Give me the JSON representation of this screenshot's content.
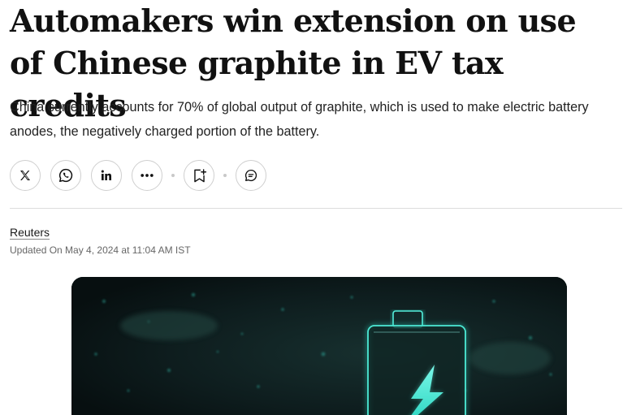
{
  "article": {
    "headline": "Automakers win extension on use of Chinese graphite in EV tax credits",
    "summary": "China currently accounts for 70% of global output of graphite, which is used to make electric battery anodes, the negatively charged portion of the battery.",
    "author": "Reuters",
    "updated": "Updated On May 4, 2024 at 11:04 AM IST"
  },
  "share_bar": {
    "buttons": [
      {
        "id": "x",
        "icon": "x-logo-icon"
      },
      {
        "id": "whatsapp",
        "icon": "whatsapp-icon"
      },
      {
        "id": "linkedin",
        "icon": "linkedin-icon"
      },
      {
        "id": "more",
        "icon": "more-horizontal-icon"
      },
      {
        "id": "bookmark",
        "icon": "bookmark-add-icon"
      },
      {
        "id": "comment",
        "icon": "comment-icon"
      }
    ]
  },
  "colors": {
    "text": "#111111",
    "muted": "#666666",
    "border": "#cfcfcf",
    "hero_bg": "#0b1617",
    "hero_glow": "#34e8d2"
  }
}
